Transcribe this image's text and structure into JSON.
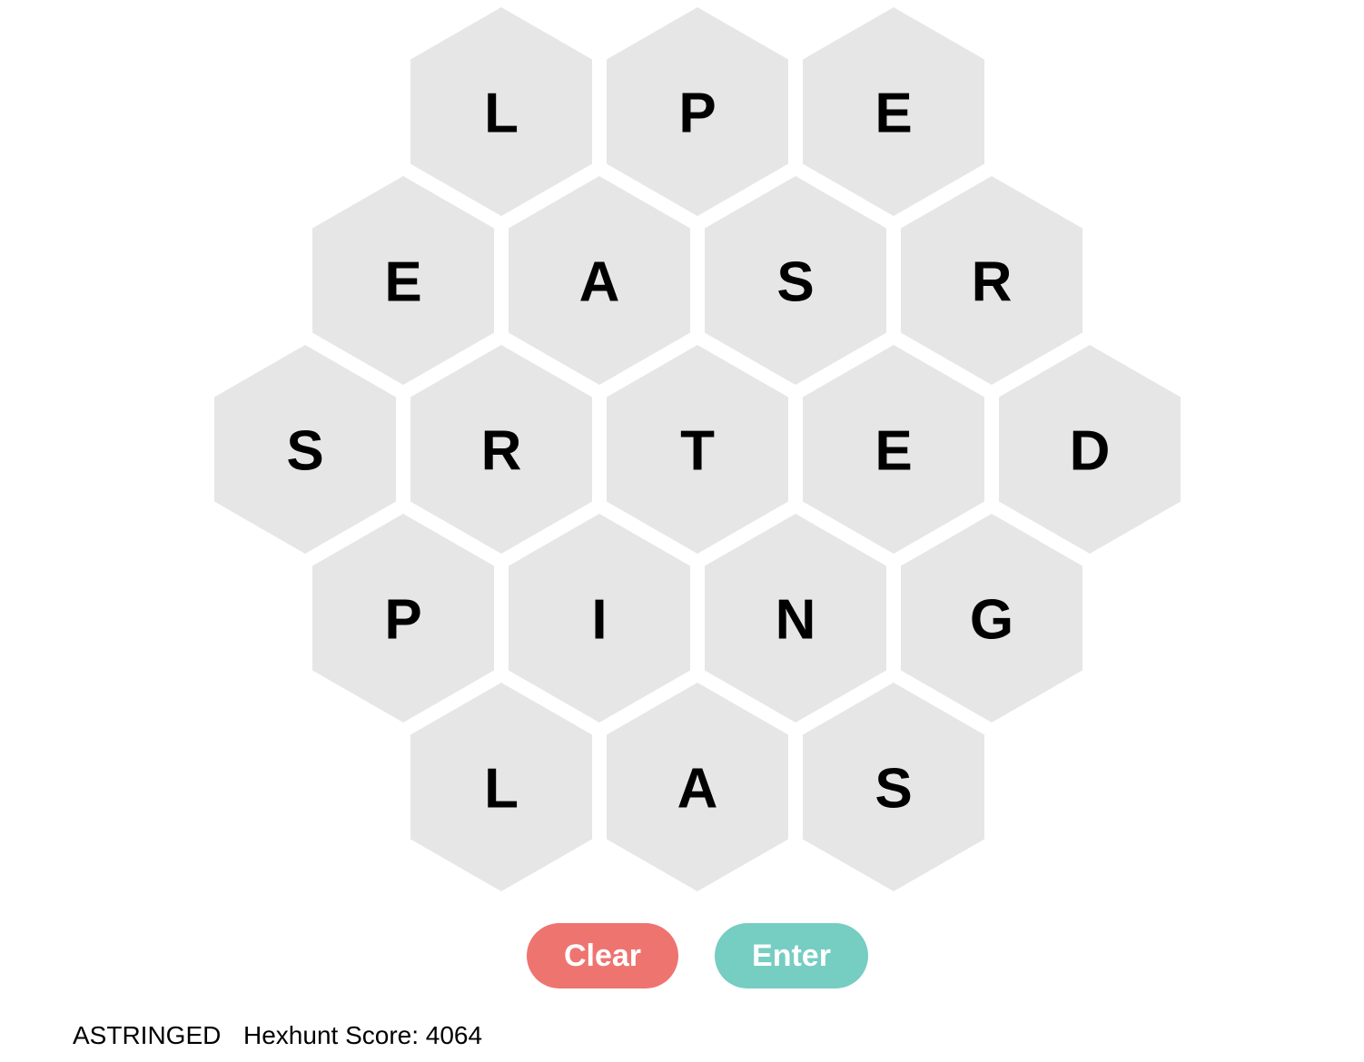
{
  "board": {
    "rows": [
      [
        "L",
        "P",
        "E"
      ],
      [
        "E",
        "A",
        "S",
        "R"
      ],
      [
        "S",
        "R",
        "T",
        "E",
        "D"
      ],
      [
        "P",
        "I",
        "N",
        "G"
      ],
      [
        "L",
        "A",
        "S"
      ]
    ]
  },
  "buttons": {
    "clear_label": "Clear",
    "enter_label": "Enter"
  },
  "status": {
    "current_word": "ASTRINGED",
    "score_label": "Hexhunt Score:",
    "score_value": "4064"
  },
  "colors": {
    "tile": "#e6e6e6",
    "clear_button": "#ee7470",
    "enter_button": "#76cdc2"
  }
}
